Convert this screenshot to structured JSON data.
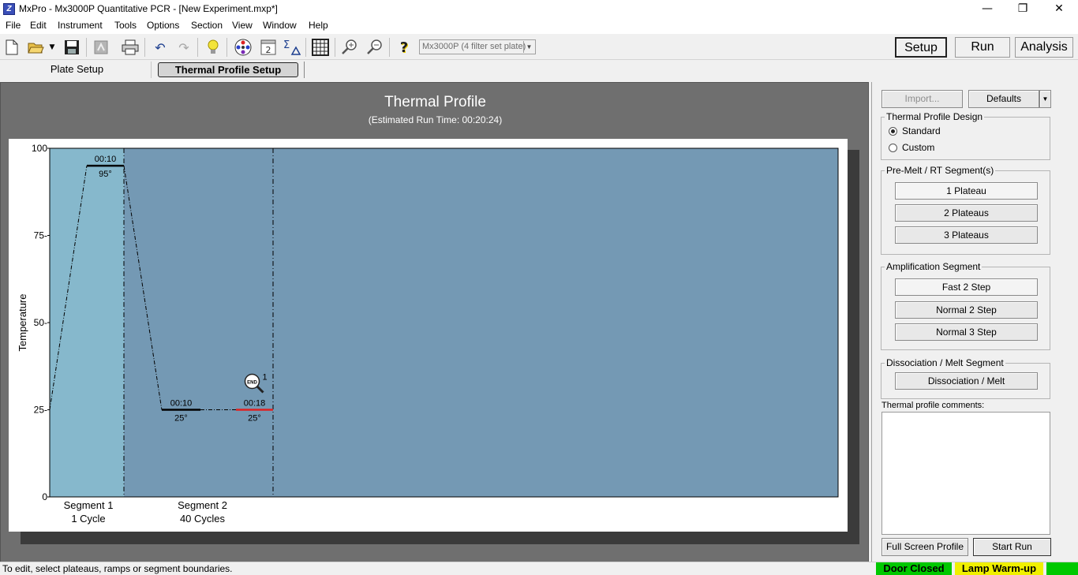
{
  "window": {
    "title": "MxPro - Mx3000P Quantitative PCR - [New Experiment.mxp*]",
    "minimize": "—",
    "maximize": "❐",
    "close": "✕"
  },
  "menu": [
    "File",
    "Edit",
    "Instrument",
    "Tools",
    "Options",
    "Section",
    "View",
    "Window",
    "Help"
  ],
  "toolbar": {
    "instrument_select": "Mx3000P (4 filter set plate)",
    "modes": [
      "Setup",
      "Run",
      "Analysis"
    ],
    "active_mode": "Setup",
    "icons": [
      "new-file-icon",
      "open-folder-icon",
      "save-icon",
      "properties-icon",
      "print-icon",
      "undo-icon",
      "redo-icon",
      "lightbulb-icon",
      "plate-icon",
      "page-2-icon",
      "sigma-delta-icon",
      "grid-icon",
      "zoom-in-icon",
      "zoom-out-icon",
      "help-icon"
    ],
    "page_icon_text": "2"
  },
  "subtabs": {
    "plate_setup": "Plate Setup",
    "thermal_profile_setup": "Thermal Profile Setup",
    "active": "Thermal Profile Setup"
  },
  "plot": {
    "title": "Thermal Profile",
    "subtitle": "(Estimated Run Time: 00:20:24)"
  },
  "chart_data": {
    "type": "line",
    "ylabel": "Temperature",
    "ylim": [
      0,
      100
    ],
    "yticks": [
      "100",
      "75-",
      "50-",
      "25-",
      "0"
    ],
    "segments": [
      {
        "name": "Segment 1",
        "cycles": "1 Cycle",
        "color": "#86b8cc",
        "plateaus": [
          {
            "temp": 95,
            "temp_label": "95°",
            "time": "00:10"
          }
        ]
      },
      {
        "name": "Segment 2",
        "cycles": "40 Cycles",
        "color": "#7499b4",
        "plateaus": [
          {
            "temp": 25,
            "temp_label": "25°",
            "time": "00:10"
          },
          {
            "temp": 25,
            "temp_label": "25°",
            "time": "00:18",
            "selected": true,
            "end_marker": "END",
            "end_count": "1"
          }
        ]
      }
    ],
    "empty_region_color": "#7499b4",
    "selected_color": "#e02020"
  },
  "right": {
    "import": "Import...",
    "defaults": "Defaults",
    "defaults_arrow": "▼",
    "design_group": "Thermal Profile Design",
    "design_options": [
      {
        "label": "Standard",
        "checked": true
      },
      {
        "label": "Custom",
        "checked": false
      }
    ],
    "premelt_group": "Pre-Melt / RT Segment(s)",
    "premelt_buttons": [
      "1 Plateau",
      "2 Plateaus",
      "3 Plateaus"
    ],
    "amp_group": "Amplification Segment",
    "amp_buttons": [
      "Fast 2 Step",
      "Normal 2 Step",
      "Normal 3 Step"
    ],
    "diss_group": "Dissociation / Melt Segment",
    "diss_button": "Dissociation / Melt",
    "comments_label": "Thermal profile comments:",
    "comments_value": "",
    "full_screen": "Full Screen Profile",
    "start_run": "Start Run"
  },
  "status": {
    "message": "To edit, select plateaus, ramps or segment boundaries.",
    "door": "Door Closed",
    "lamp": "Lamp Warm-up",
    "door_color": "#00c800",
    "lamp_color": "#f0f000"
  }
}
